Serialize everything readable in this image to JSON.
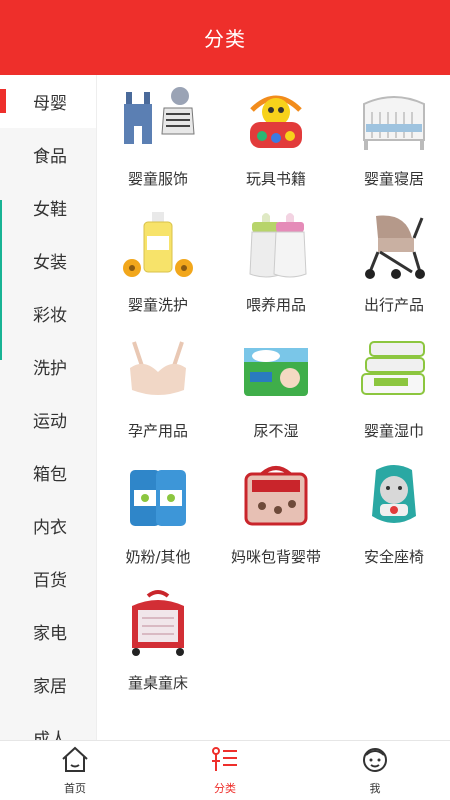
{
  "header": {
    "title": "分类"
  },
  "sidebar": {
    "items": [
      {
        "label": "母婴",
        "active": true
      },
      {
        "label": "食品"
      },
      {
        "label": "女鞋"
      },
      {
        "label": "女装"
      },
      {
        "label": "彩妆"
      },
      {
        "label": "洗护"
      },
      {
        "label": "运动"
      },
      {
        "label": "箱包"
      },
      {
        "label": "内衣"
      },
      {
        "label": "百货"
      },
      {
        "label": "家电"
      },
      {
        "label": "家居"
      },
      {
        "label": "成人"
      }
    ]
  },
  "categories": [
    {
      "label": "婴童服饰",
      "icon": "overalls-icon"
    },
    {
      "label": "玩具书籍",
      "icon": "toy-activity-icon"
    },
    {
      "label": "婴童寝居",
      "icon": "crib-icon"
    },
    {
      "label": "婴童洗护",
      "icon": "lotion-bottle-icon"
    },
    {
      "label": "喂养用品",
      "icon": "baby-bottles-icon"
    },
    {
      "label": "出行产品",
      "icon": "stroller-icon"
    },
    {
      "label": "孕产用品",
      "icon": "maternity-bra-icon"
    },
    {
      "label": "尿不湿",
      "icon": "diaper-pack-icon"
    },
    {
      "label": "婴童湿巾",
      "icon": "wet-wipes-icon"
    },
    {
      "label": "奶粉/其他",
      "icon": "formula-can-icon"
    },
    {
      "label": "妈咪包背婴带",
      "icon": "diaper-bag-icon"
    },
    {
      "label": "安全座椅",
      "icon": "car-seat-icon"
    },
    {
      "label": "童桌童床",
      "icon": "playpen-icon"
    }
  ],
  "tabbar": {
    "items": [
      {
        "label": "首页",
        "icon": "home-icon"
      },
      {
        "label": "分类",
        "icon": "category-icon",
        "active": true
      },
      {
        "label": "我",
        "icon": "profile-face-icon"
      }
    ]
  },
  "colors": {
    "brand": "#ee2f2b",
    "sidebar_bg": "#f6f6f6",
    "text": "#333333"
  }
}
